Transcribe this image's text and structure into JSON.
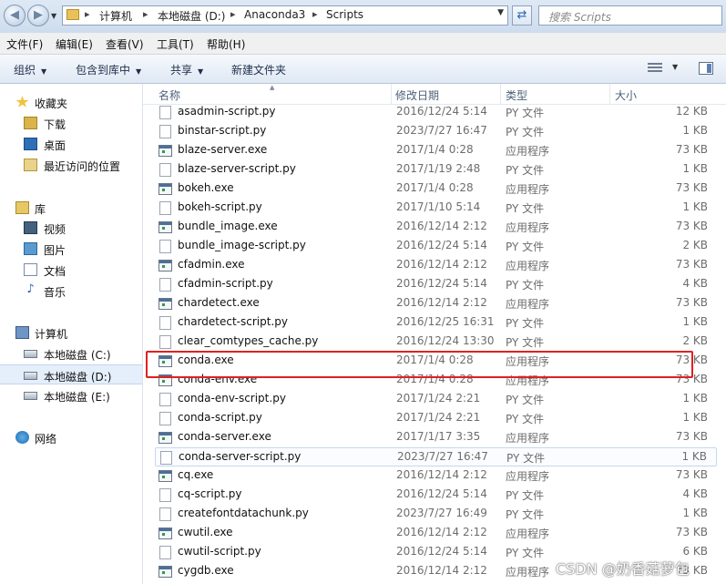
{
  "address": {
    "crumbs": [
      "计算机",
      "本地磁盘 (D:)",
      "Anaconda3",
      "Scripts"
    ],
    "search_placeholder": "搜索 Scripts"
  },
  "menu": [
    "文件(F)",
    "编辑(E)",
    "查看(V)",
    "工具(T)",
    "帮助(H)"
  ],
  "toolbar": {
    "organize": "组织",
    "include_library": "包含到库中",
    "share": "共享",
    "new_folder": "新建文件夹"
  },
  "sidebar": {
    "favorites": "收藏夹",
    "downloads": "下载",
    "desktop": "桌面",
    "recent": "最近访问的位置",
    "libraries": "库",
    "videos": "视频",
    "pictures": "图片",
    "documents": "文档",
    "music": "音乐",
    "computer": "计算机",
    "drive_c": "本地磁盘 (C:)",
    "drive_d": "本地磁盘 (D:)",
    "drive_e": "本地磁盘 (E:)",
    "network": "网络"
  },
  "columns": {
    "name": "名称",
    "modified": "修改日期",
    "type": "类型",
    "size": "大小"
  },
  "files": [
    {
      "name": "asadmin-script.py",
      "date": "2016/12/24 5:14",
      "type": "PY 文件",
      "size": "12 KB",
      "icon": "py-file-icon"
    },
    {
      "name": "binstar-script.py",
      "date": "2023/7/27 16:47",
      "type": "PY 文件",
      "size": "1 KB",
      "icon": "py-file-icon"
    },
    {
      "name": "blaze-server.exe",
      "date": "2017/1/4 0:28",
      "type": "应用程序",
      "size": "73 KB",
      "icon": "exe-icon"
    },
    {
      "name": "blaze-server-script.py",
      "date": "2017/1/19 2:48",
      "type": "PY 文件",
      "size": "1 KB",
      "icon": "py-file-icon"
    },
    {
      "name": "bokeh.exe",
      "date": "2017/1/4 0:28",
      "type": "应用程序",
      "size": "73 KB",
      "icon": "exe-icon"
    },
    {
      "name": "bokeh-script.py",
      "date": "2017/1/10 5:14",
      "type": "PY 文件",
      "size": "1 KB",
      "icon": "py-file-icon"
    },
    {
      "name": "bundle_image.exe",
      "date": "2016/12/14 2:12",
      "type": "应用程序",
      "size": "73 KB",
      "icon": "exe-icon"
    },
    {
      "name": "bundle_image-script.py",
      "date": "2016/12/24 5:14",
      "type": "PY 文件",
      "size": "2 KB",
      "icon": "py-file-icon"
    },
    {
      "name": "cfadmin.exe",
      "date": "2016/12/14 2:12",
      "type": "应用程序",
      "size": "73 KB",
      "icon": "exe-icon"
    },
    {
      "name": "cfadmin-script.py",
      "date": "2016/12/24 5:14",
      "type": "PY 文件",
      "size": "4 KB",
      "icon": "py-file-icon"
    },
    {
      "name": "chardetect.exe",
      "date": "2016/12/14 2:12",
      "type": "应用程序",
      "size": "73 KB",
      "icon": "exe-icon"
    },
    {
      "name": "chardetect-script.py",
      "date": "2016/12/25 16:31",
      "type": "PY 文件",
      "size": "1 KB",
      "icon": "py-file-icon"
    },
    {
      "name": "clear_comtypes_cache.py",
      "date": "2016/12/24 13:30",
      "type": "PY 文件",
      "size": "2 KB",
      "icon": "py-file-icon"
    },
    {
      "name": "conda.exe",
      "date": "2017/1/4 0:28",
      "type": "应用程序",
      "size": "73 KB",
      "icon": "exe-icon"
    },
    {
      "name": "conda-env.exe",
      "date": "2017/1/4 0:28",
      "type": "应用程序",
      "size": "73 KB",
      "icon": "exe-icon"
    },
    {
      "name": "conda-env-script.py",
      "date": "2017/1/24 2:21",
      "type": "PY 文件",
      "size": "1 KB",
      "icon": "py-file-icon"
    },
    {
      "name": "conda-script.py",
      "date": "2017/1/24 2:21",
      "type": "PY 文件",
      "size": "1 KB",
      "icon": "py-file-icon"
    },
    {
      "name": "conda-server.exe",
      "date": "2017/1/17 3:35",
      "type": "应用程序",
      "size": "73 KB",
      "icon": "exe-icon"
    },
    {
      "name": "conda-server-script.py",
      "date": "2023/7/27 16:47",
      "type": "PY 文件",
      "size": "1 KB",
      "icon": "py-file-icon"
    },
    {
      "name": "cq.exe",
      "date": "2016/12/14 2:12",
      "type": "应用程序",
      "size": "73 KB",
      "icon": "exe-icon"
    },
    {
      "name": "cq-script.py",
      "date": "2016/12/24 5:14",
      "type": "PY 文件",
      "size": "4 KB",
      "icon": "py-file-icon"
    },
    {
      "name": "createfontdatachunk.py",
      "date": "2023/7/27 16:49",
      "type": "PY 文件",
      "size": "1 KB",
      "icon": "py-file-icon"
    },
    {
      "name": "cwutil.exe",
      "date": "2016/12/14 2:12",
      "type": "应用程序",
      "size": "73 KB",
      "icon": "exe-icon"
    },
    {
      "name": "cwutil-script.py",
      "date": "2016/12/24 5:14",
      "type": "PY 文件",
      "size": "6 KB",
      "icon": "py-file-icon"
    },
    {
      "name": "cygdb.exe",
      "date": "2016/12/14 2:12",
      "type": "应用程序",
      "size": "73 KB",
      "icon": "exe-icon"
    }
  ],
  "highlight_color": "#e02020",
  "watermark": "CSDN @奶香菇萝包"
}
